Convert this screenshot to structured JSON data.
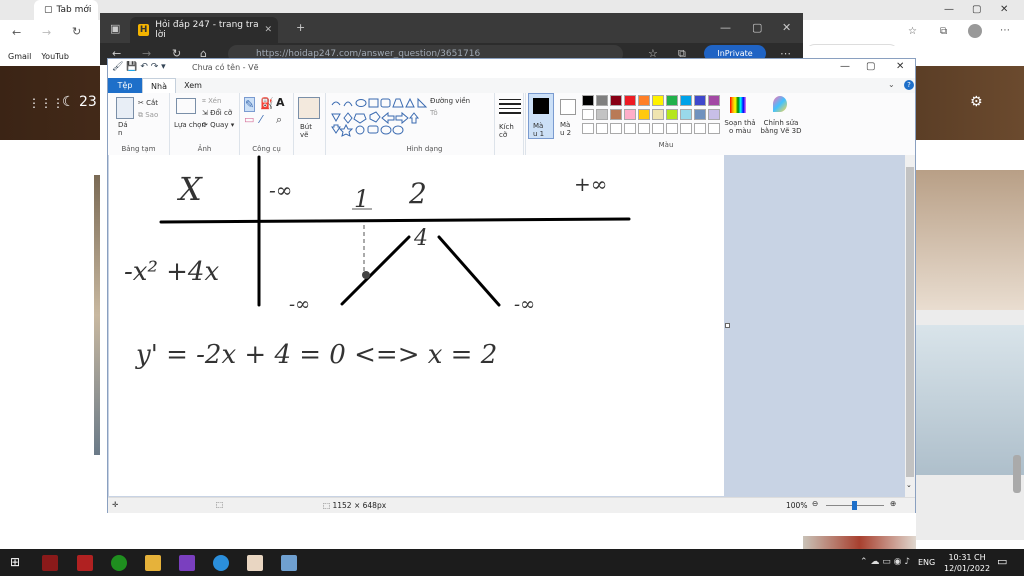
{
  "browser_bg": {
    "tab_title": "Tab mới",
    "favorites": [
      "Gmail",
      "YouTub"
    ],
    "temperature": "23"
  },
  "browser2": {
    "tab_title": "Hỏi đáp 247 - trang tra lời",
    "url": "https://hoidap247.com/answer_question/3651716",
    "inprivate_label": "InPrivate"
  },
  "paint": {
    "title": "Chưa có tên - Vẽ",
    "tabs": {
      "file": "Tệp",
      "home": "Nhà",
      "view": "Xem"
    },
    "clipboard": {
      "paste": "Dá n",
      "cut": "Cắt",
      "copy": "Sao",
      "label": "Bảng tạm"
    },
    "image": {
      "select": "Lựa chọn",
      "crop": "Xén",
      "resize": "Đổi cỡ",
      "rotate": "Quay",
      "label": "Ảnh"
    },
    "tools": {
      "label": "Công cụ"
    },
    "brushes": {
      "label": "Bút vẽ"
    },
    "shapes": {
      "outline": "Đường viền",
      "fill": "Tô",
      "label": "Hình dạng"
    },
    "size": {
      "label": "Kích cỡ"
    },
    "color1": "Mà u 1",
    "color2": "Mà u 2",
    "edit_colors": "Soạn thả o màu",
    "paint3d": "Chỉnh sửa bằng Vẽ 3D",
    "colors_label": "Màu",
    "palette_row1": [
      "#000000",
      "#7f7f7f",
      "#880015",
      "#ed1c24",
      "#ff7f27",
      "#fff200",
      "#22b14c",
      "#00a2e8",
      "#3f48cc",
      "#a349a4"
    ],
    "palette_row2": [
      "#ffffff",
      "#c3c3c3",
      "#b97a57",
      "#ffaec9",
      "#ffc90e",
      "#efe4b0",
      "#b5e61d",
      "#99d9ea",
      "#7092be",
      "#c8bfe7"
    ],
    "status": {
      "dimensions": "1152 × 648px",
      "zoom": "100%"
    },
    "drawing": {
      "header_x": "X",
      "minus_inf": "-∞",
      "one": "1",
      "two": "2",
      "plus_inf": "+∞",
      "four": "4",
      "func": "-x² +4x",
      "bottom_left": "-∞",
      "bottom_right": "-∞",
      "equation": "y' = -2x + 4 = 0 <=> x = 2"
    }
  },
  "taskbar": {
    "lang": "ENG",
    "time": "10:31 CH",
    "date": "12/01/2022"
  }
}
